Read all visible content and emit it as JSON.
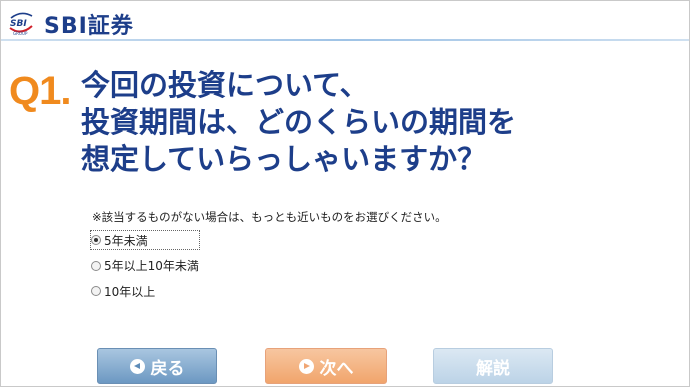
{
  "header": {
    "brand": "SBI証券",
    "logo_mark_text": "SBI",
    "logo_mark_subtext": "GROUP"
  },
  "question": {
    "number": "Q1.",
    "lines": [
      "今回の投資について、",
      "投資期間は、どのくらいの期間を",
      "想定していらっしゃいますか？"
    ],
    "note": "※該当するものがない場合は、もっとも近いものをお選びください。"
  },
  "options": [
    {
      "label": "5年未満",
      "selected": true
    },
    {
      "label": "5年以上10年未満",
      "selected": false
    },
    {
      "label": "10年以上",
      "selected": false
    }
  ],
  "buttons": {
    "back": "戻る",
    "next": "次へ",
    "explanation": "解説"
  },
  "colors": {
    "brand_blue": "#1d3e8a",
    "accent_orange": "#f08a1e"
  }
}
